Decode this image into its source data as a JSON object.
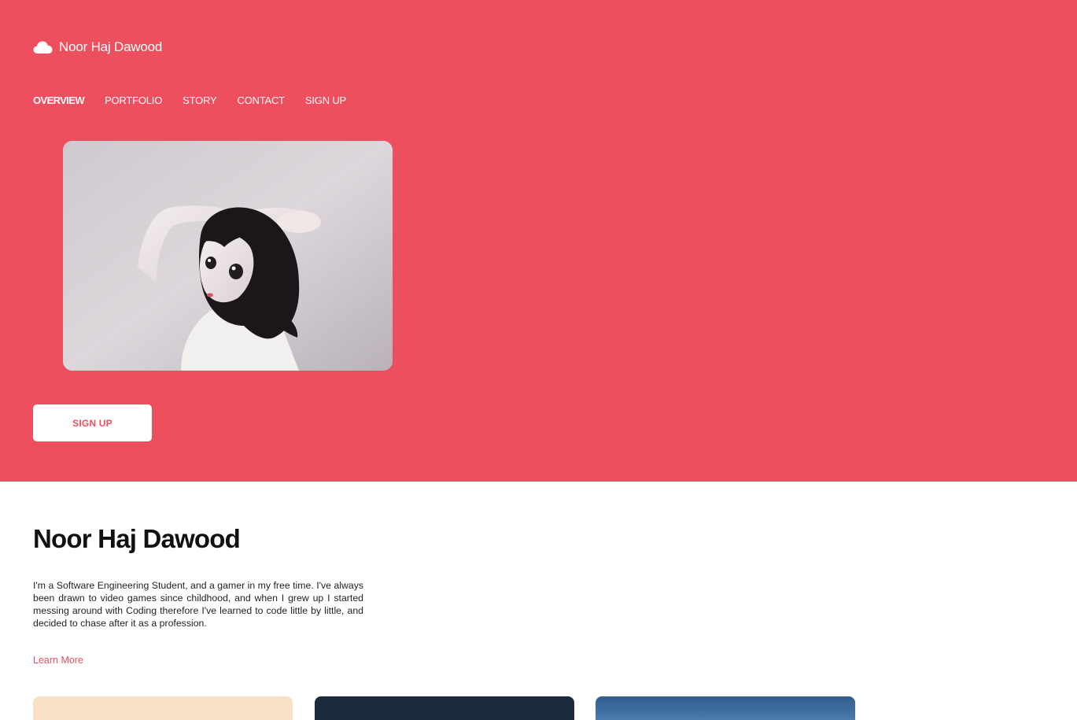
{
  "brand": {
    "name": "Noor Haj Dawood",
    "icon": "cloud-icon"
  },
  "nav": {
    "items": [
      {
        "label": "OVERVIEW",
        "active": true
      },
      {
        "label": "PORTFOLIO",
        "active": false
      },
      {
        "label": "STORY",
        "active": false
      },
      {
        "label": "CONTACT",
        "active": false
      },
      {
        "label": "SIGN UP",
        "active": false
      }
    ]
  },
  "hero": {
    "cta_label": "SIGN UP",
    "background_color": "#ee4f5e"
  },
  "about": {
    "title": "Noor Haj Dawood",
    "description": "I'm a Software Engineering Student, and a gamer in my free time. I've always been drawn to video games since childhood, and when I grew up I started messing around with Coding therefore I've learned to code little by little, and decided to chase after it as a profession.",
    "link_label": "Learn More"
  },
  "colors": {
    "accent": "#ee4f5e",
    "card_1": "#f9dfc6",
    "card_2": "#1c2a3d",
    "card_3": "#3f6fa0"
  }
}
